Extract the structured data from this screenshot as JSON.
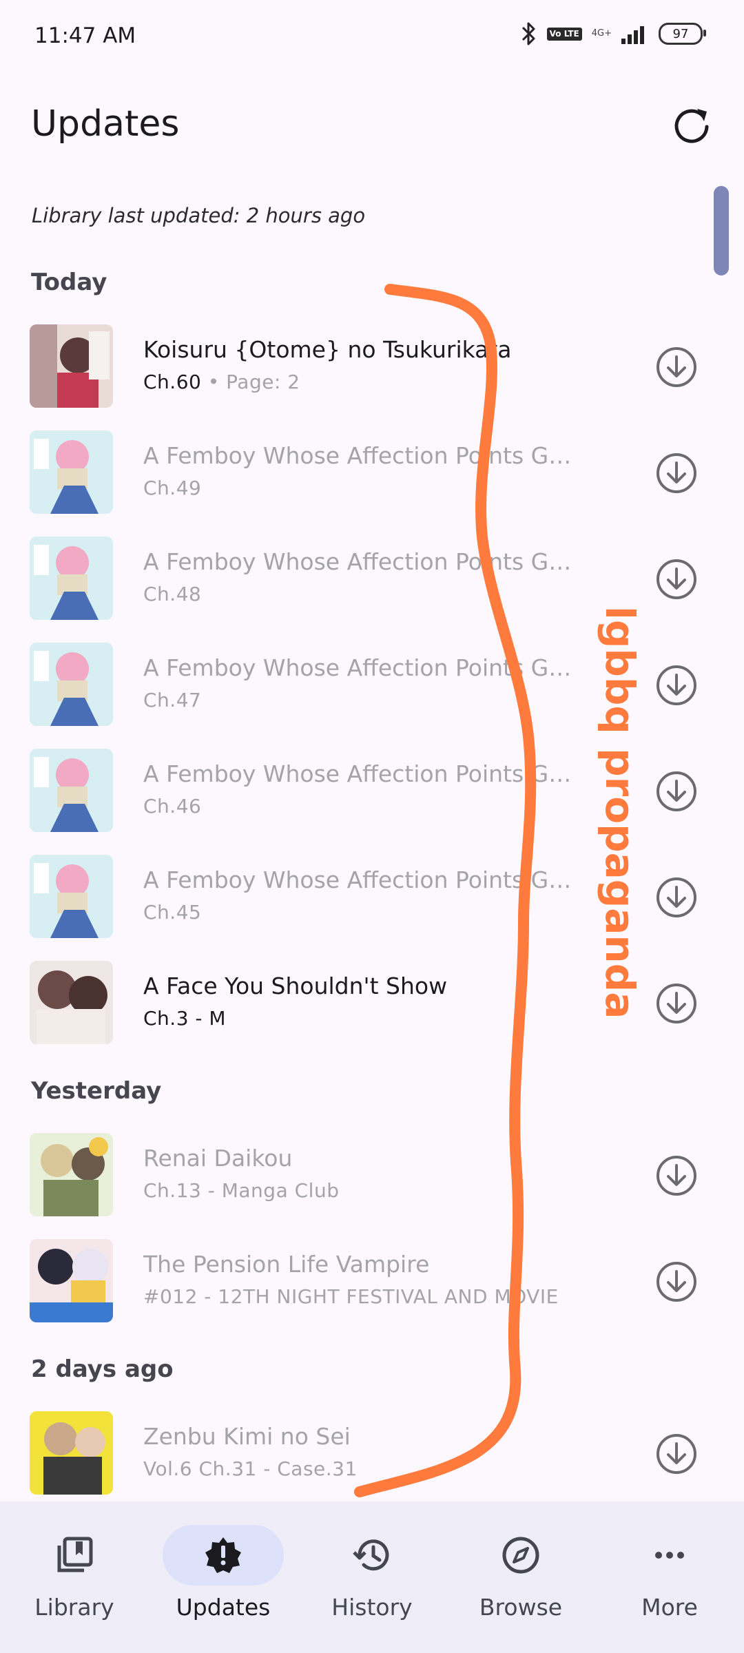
{
  "status_bar": {
    "time": "11:47 AM",
    "network": "4G+",
    "volte": "Vo LTE",
    "battery": "97"
  },
  "header": {
    "title": "Updates",
    "last_updated": "Library last updated: 2 hours ago"
  },
  "sections": [
    {
      "label": "Today"
    },
    {
      "label": "Yesterday"
    },
    {
      "label": "2 days ago"
    }
  ],
  "rows": [
    {
      "title": "Koisuru {Otome} no Tsukurikata",
      "chapter": "Ch.60",
      "separator": " • ",
      "page": "Page: 2",
      "read": false
    },
    {
      "title": "A Femboy Whose Affection Points Go ...",
      "chapter": "Ch.49",
      "read": true
    },
    {
      "title": "A Femboy Whose Affection Points Go ...",
      "chapter": "Ch.48",
      "read": true
    },
    {
      "title": "A Femboy Whose Affection Points Go ...",
      "chapter": "Ch.47",
      "read": true
    },
    {
      "title": "A Femboy Whose Affection Points Go ...",
      "chapter": "Ch.46",
      "read": true
    },
    {
      "title": "A Femboy Whose Affection Points Go ...",
      "chapter": "Ch.45",
      "read": true
    },
    {
      "title": "A Face You Shouldn't Show",
      "chapter": "Ch.3 - M",
      "read": false
    },
    {
      "title": "Renai Daikou",
      "chapter": "Ch.13 - Manga Club",
      "read": true
    },
    {
      "title": "The Pension Life Vampire",
      "chapter": "#012 - 12TH NIGHT FESTIVAL AND MOVIE",
      "read": true
    },
    {
      "title": "Zenbu Kimi no Sei",
      "chapter": "Vol.6 Ch.31 - Case.31",
      "read": true
    }
  ],
  "annotation": {
    "text": "lgbbq propaganda",
    "color": "#ff7a3d"
  },
  "nav": [
    {
      "label": "Library",
      "icon": "library-icon"
    },
    {
      "label": "Updates",
      "icon": "updates-alert-icon",
      "active": true
    },
    {
      "label": "History",
      "icon": "history-icon"
    },
    {
      "label": "Browse",
      "icon": "compass-icon"
    },
    {
      "label": "More",
      "icon": "more-dots-icon"
    }
  ],
  "colors": {
    "background": "#fcf8fd",
    "nav_background": "#efedf8",
    "active_pill": "#dde1fa",
    "scrollbar": "#7e86b8",
    "read_text": "#a3a3a8"
  }
}
